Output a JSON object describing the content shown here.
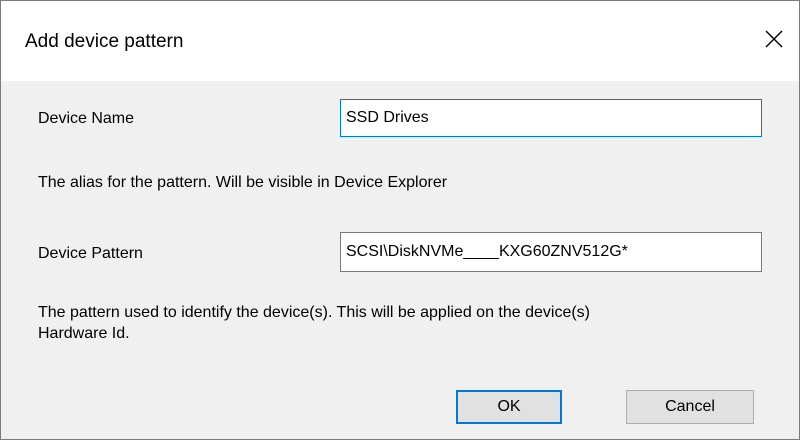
{
  "window": {
    "title": "Add device pattern",
    "close_icon": "close-icon"
  },
  "form": {
    "device_name_label": "Device Name",
    "device_name_value": "SSD Drives",
    "device_name_help": "The alias for the pattern. Will be visible in Device Explorer",
    "device_pattern_label": "Device Pattern",
    "device_pattern_value": "SCSI\\DiskNVMe____KXG60ZNV512G*",
    "device_pattern_help_line1": "The pattern used to identify the device(s). This will be applied on the device(s)",
    "device_pattern_help_line2": "Hardware Id."
  },
  "buttons": {
    "ok_label": "OK",
    "cancel_label": "Cancel"
  },
  "colors": {
    "focus_border": "#0078d7",
    "button_face": "#e1e1e1",
    "dialog_background": "#f0f0f0"
  }
}
